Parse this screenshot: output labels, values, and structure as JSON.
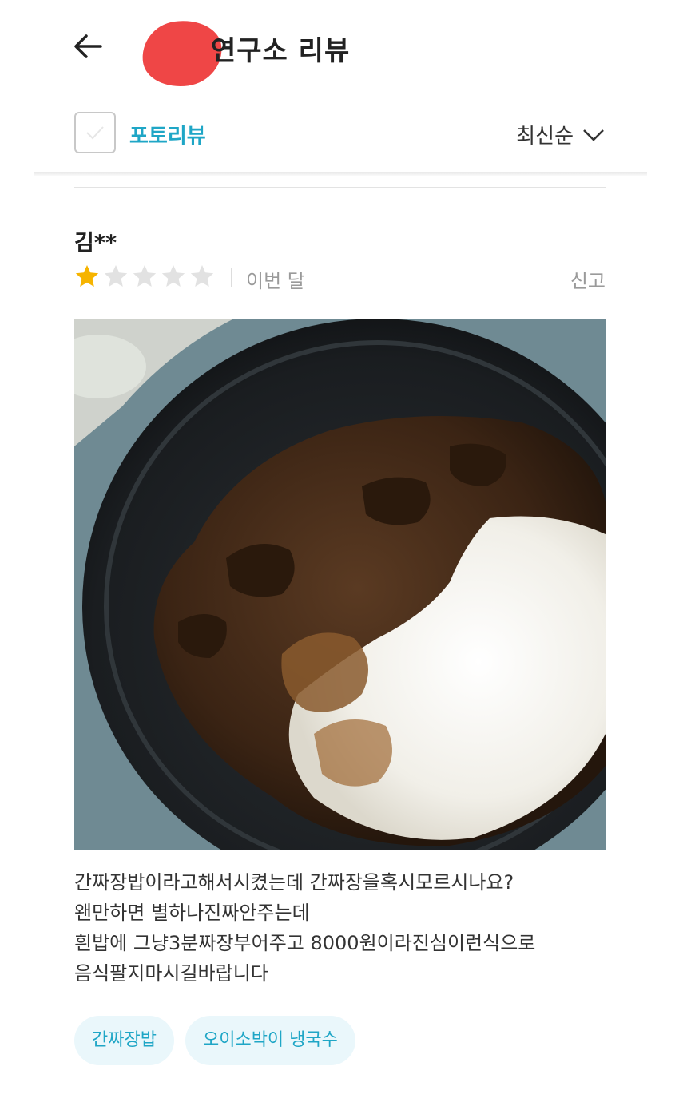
{
  "header": {
    "title": "연구소 리뷰",
    "back_icon": "arrow-left-icon"
  },
  "filter": {
    "photo_review_label": "포토리뷰",
    "photo_review_checked": false,
    "sort_label": "최신순"
  },
  "review": {
    "reviewer": "김**",
    "rating": 1,
    "max_rating": 5,
    "date": "이번 달",
    "report_label": "신고",
    "text": "간짜장밥이라고해서시켰는데 간짜장을혹시모르시나요?\n왠만하면 별하나진짜안주는데\n흰밥에 그냥3분짜장부어주고 8000원이라진심이런식으로\n음식팔지마시길바랍니다",
    "tags": [
      "간짜장밥",
      "오이소박이 냉국수"
    ]
  },
  "colors": {
    "accent": "#1fa6c6",
    "star_filled": "#f6b400",
    "star_empty": "#e2e2e2",
    "redaction": "#ef4646"
  }
}
